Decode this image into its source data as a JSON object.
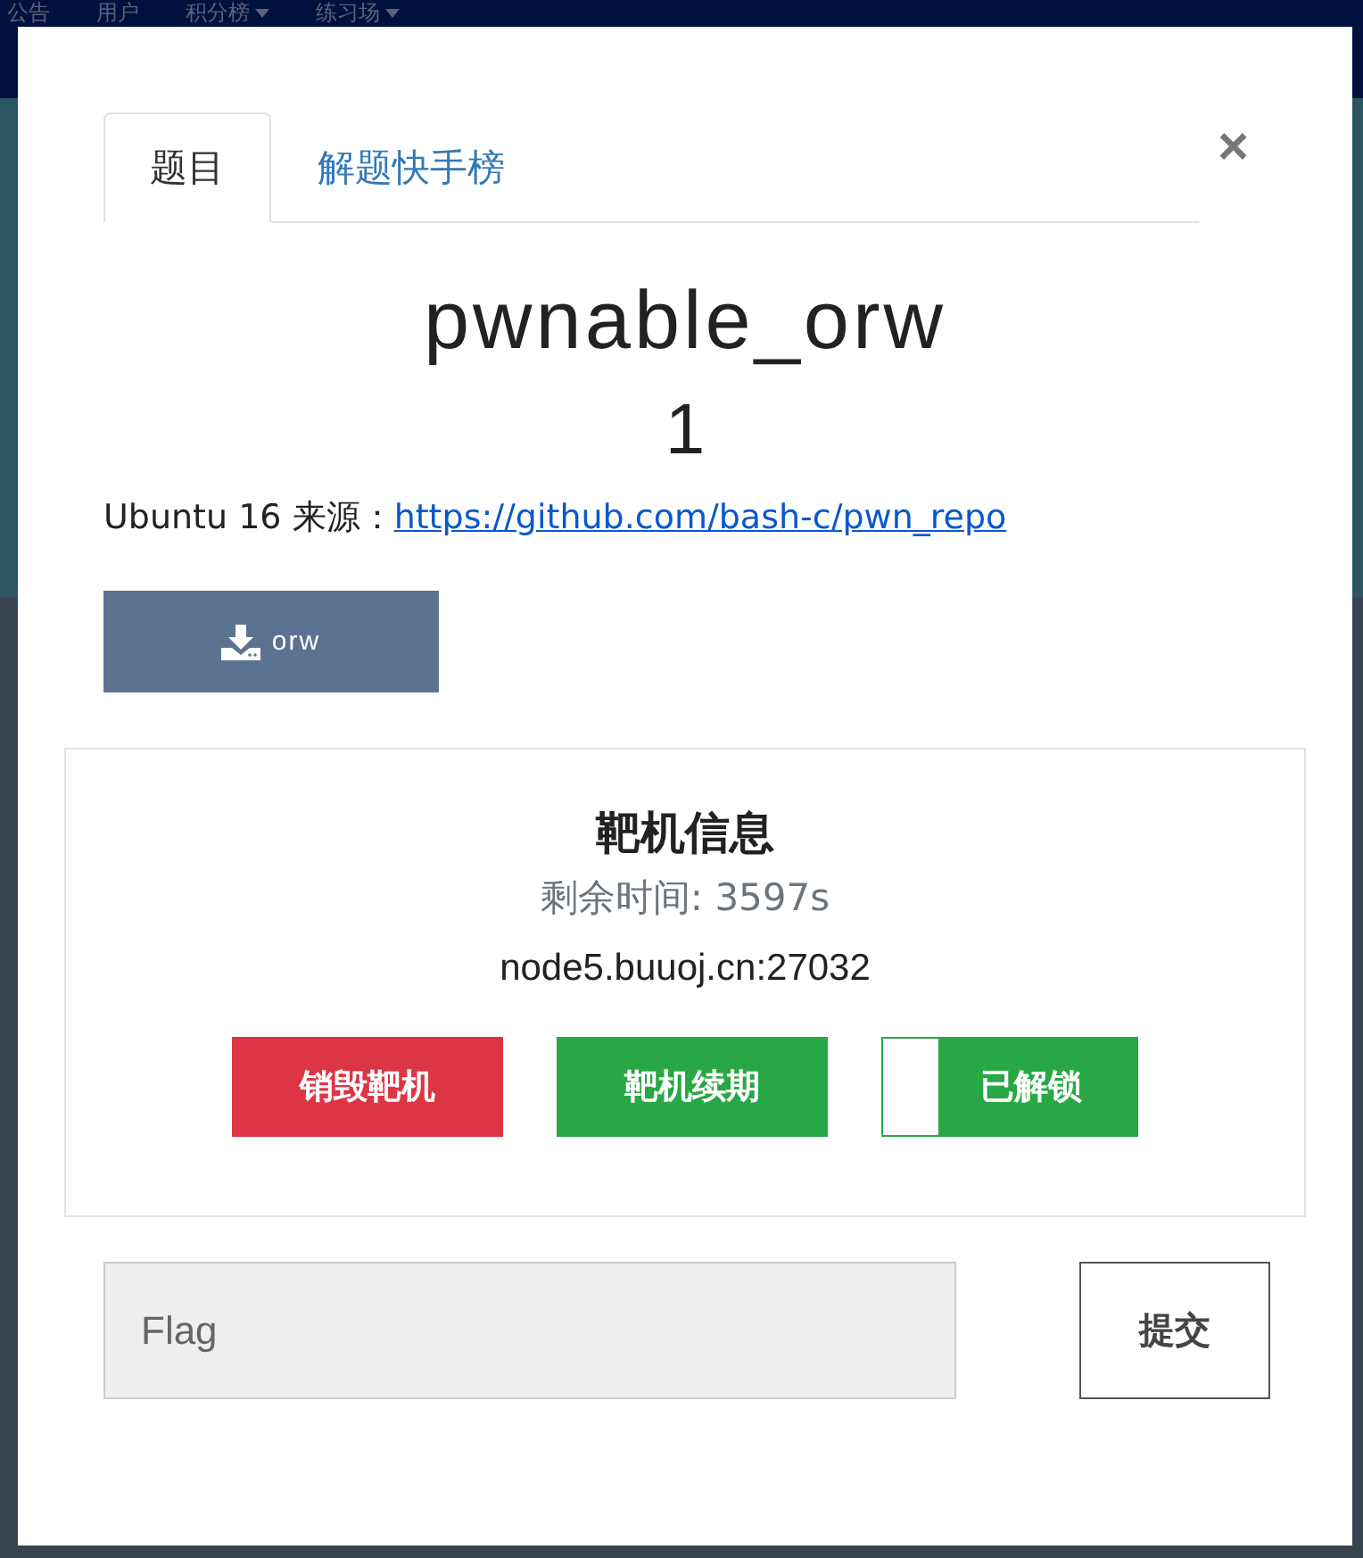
{
  "background_nav": [
    {
      "label": "公告",
      "caret": false
    },
    {
      "label": "用户",
      "caret": false
    },
    {
      "label": "积分榜",
      "caret": true
    },
    {
      "label": "练习场",
      "caret": true
    }
  ],
  "modal": {
    "tabs": [
      {
        "label": "题目",
        "selected": true
      },
      {
        "label": "解题快手榜",
        "selected": false
      }
    ],
    "close": "×",
    "title": "pwnable_orw",
    "score": "1",
    "source_text": "Ubuntu 16 来源：",
    "source_link": "https://github.com/bash-c/pwn_repo",
    "download": {
      "label": "orw"
    },
    "target": {
      "heading": "靶机信息",
      "time_label": "剩余时间:",
      "time_value": "3597s",
      "address": "node5.buuoj.cn:27032",
      "buttons": [
        {
          "label": "销毁靶机",
          "kind": "danger"
        },
        {
          "label": "靶机续期",
          "kind": "success"
        },
        {
          "label": "已解锁",
          "kind": "toggle",
          "on": true
        }
      ]
    },
    "flag": {
      "placeholder": "Flag"
    },
    "submit": "提交"
  }
}
